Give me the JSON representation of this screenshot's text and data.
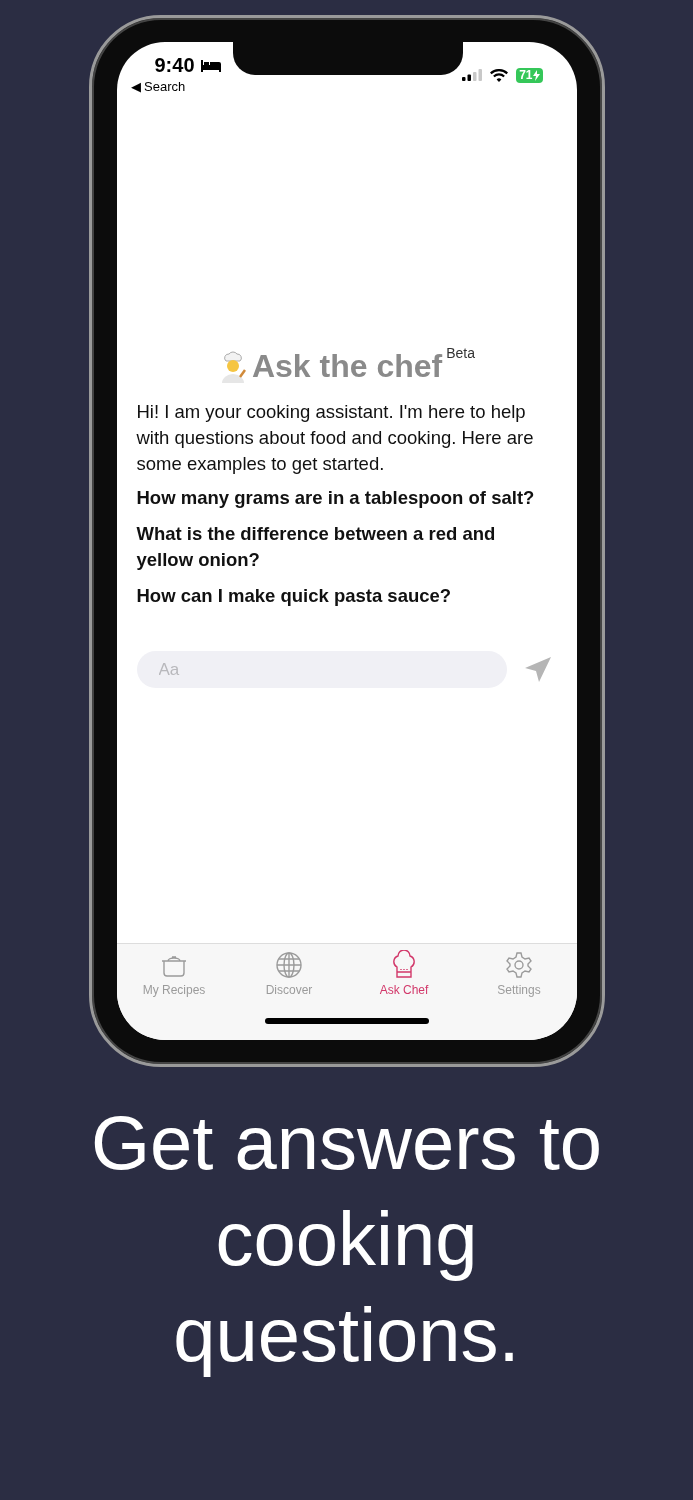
{
  "status_bar": {
    "time": "9:40",
    "back_label": "◀ Search",
    "battery": "71"
  },
  "header": {
    "title": "Ask the chef",
    "badge": "Beta"
  },
  "intro": "Hi! I am your cooking assistant. I'm here to help with questions about food and cooking. Here are some examples to get started.",
  "examples": [
    "How many grams are in a tablespoon of salt?",
    "What is the difference between a red and yellow onion?",
    "How can I make quick pasta sauce?"
  ],
  "message_field": {
    "placeholder": "Aa"
  },
  "tabs": [
    {
      "label": "My Recipes",
      "selected": false
    },
    {
      "label": "Discover",
      "selected": false
    },
    {
      "label": "Ask Chef",
      "selected": true
    },
    {
      "label": "Settings",
      "selected": false
    }
  ],
  "caption": "Get answers to cooking questions."
}
